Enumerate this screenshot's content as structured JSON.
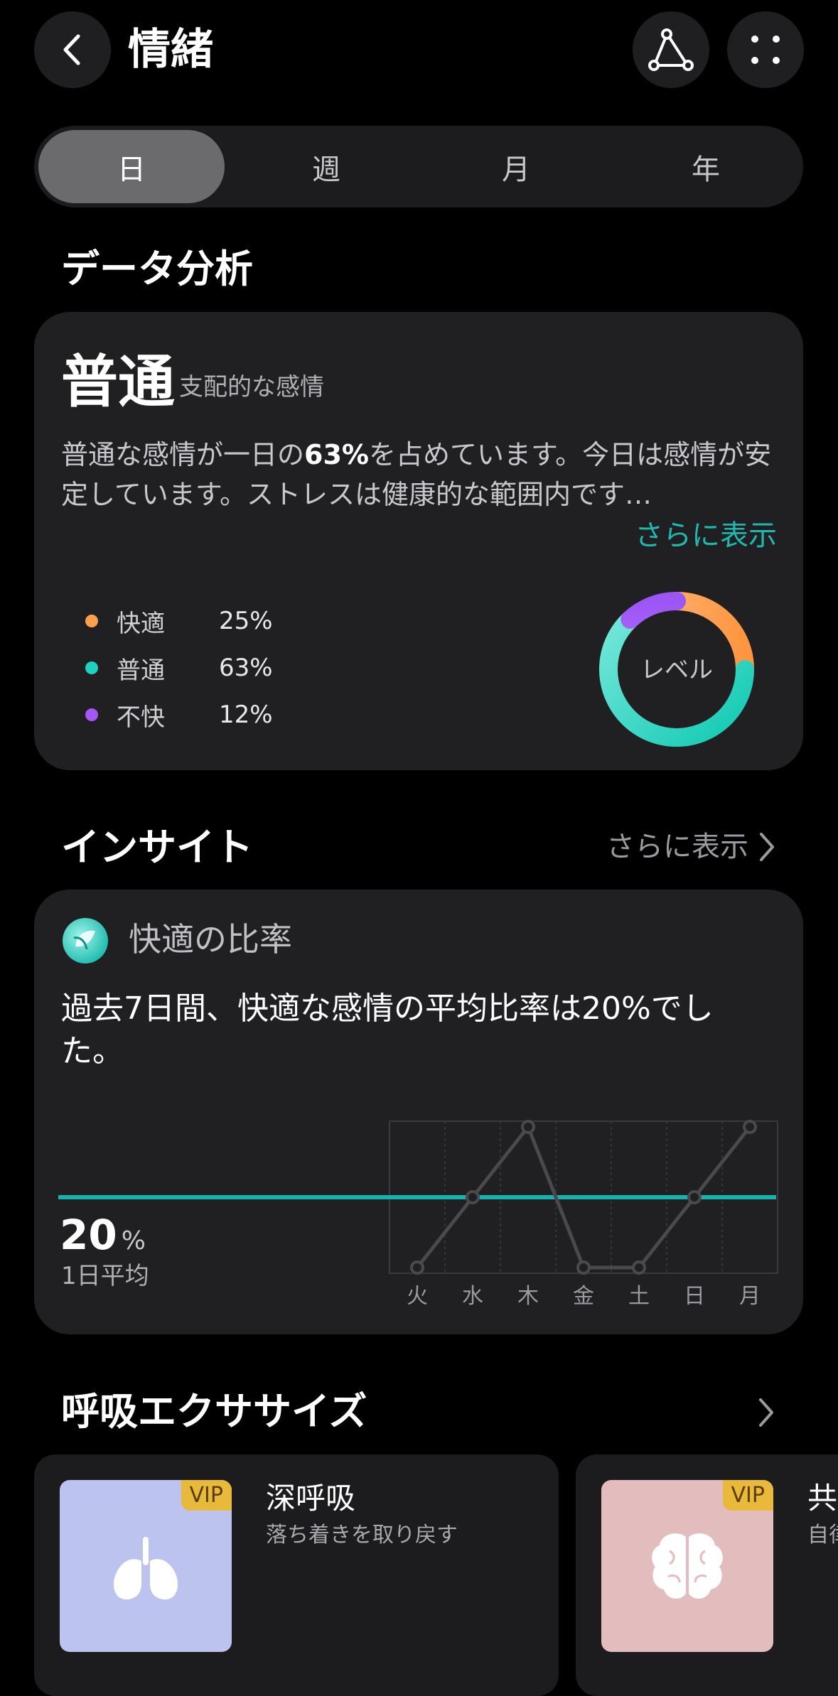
{
  "header": {
    "title": "情緒"
  },
  "tabs": [
    {
      "label": "日",
      "active": true
    },
    {
      "label": "週",
      "active": false
    },
    {
      "label": "月",
      "active": false
    },
    {
      "label": "年",
      "active": false
    }
  ],
  "analysis": {
    "section_title": "データ分析",
    "dominant": "普通",
    "dominant_sub": "支配的な感情",
    "desc_pre": "普通な感情が一日の",
    "desc_highlight": "63%",
    "desc_post": "を占めています。今日は感情が安定しています。ストレスは健康的な範囲内です…",
    "more": "さらに表示",
    "donut_label": "レベル",
    "legend": [
      {
        "label": "快適",
        "value": "25%",
        "percent": 25,
        "color": "#ff9f4a"
      },
      {
        "label": "普通",
        "value": "63%",
        "percent": 63,
        "color": "#1fd1c0"
      },
      {
        "label": "不快",
        "value": "12%",
        "percent": 12,
        "color": "#a259f7"
      }
    ]
  },
  "insight": {
    "section_title": "インサイト",
    "more": "さらに表示",
    "card_title": "快適の比率",
    "text": "過去7日間、快適な感情の平均比率は20%でした。",
    "avg_value": "20",
    "avg_unit": "%",
    "avg_label": "1日平均"
  },
  "chart_data": {
    "type": "line",
    "categories": [
      "火",
      "水",
      "木",
      "金",
      "土",
      "日",
      "月"
    ],
    "values": [
      0,
      20,
      40,
      0,
      0,
      20,
      40
    ],
    "average": 20,
    "ylim": [
      0,
      40
    ],
    "grid": true
  },
  "breathing": {
    "section_title": "呼吸エクササイズ",
    "cards": [
      {
        "title": "深呼吸",
        "subtitle": "落ち着きを取り戻す",
        "badge": "VIP",
        "color": "#bcc3ef"
      },
      {
        "title": "共鳴呼吸",
        "subtitle": "自律神経を整える",
        "badge": "VIP",
        "color": "#e3bdbd"
      }
    ]
  }
}
